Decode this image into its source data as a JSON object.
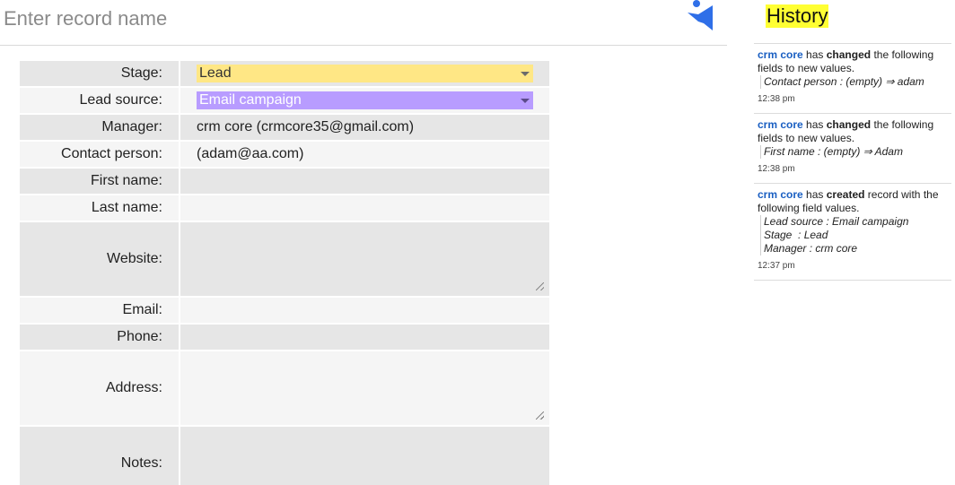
{
  "header": {
    "record_name_placeholder": "Enter record name"
  },
  "form": {
    "stage": {
      "label": "Stage:",
      "value": "Lead"
    },
    "lead_source": {
      "label": "Lead source:",
      "value": "Email campaign"
    },
    "manager": {
      "label": "Manager:",
      "value": "crm core (crmcore35@gmail.com)"
    },
    "contact_person": {
      "label": "Contact person:",
      "value": "(adam@aa.com)"
    },
    "first_name": {
      "label": "First name:",
      "value": ""
    },
    "last_name": {
      "label": "Last name:",
      "value": ""
    },
    "website": {
      "label": "Website:",
      "value": ""
    },
    "email": {
      "label": "Email:",
      "value": ""
    },
    "phone": {
      "label": "Phone:",
      "value": ""
    },
    "address": {
      "label": "Address:",
      "value": ""
    },
    "notes": {
      "label": "Notes:",
      "value": ""
    }
  },
  "history": {
    "title": "History",
    "entries": [
      {
        "user": "crm core",
        "action_pre": "has",
        "action": "changed",
        "action_post": "the following fields to new values.",
        "changes": [
          "Contact person : (empty) ⇒ adam"
        ],
        "time": "12:38 pm"
      },
      {
        "user": "crm core",
        "action_pre": "has",
        "action": "changed",
        "action_post": "the following fields to new values.",
        "changes": [
          "First name : (empty) ⇒ Adam"
        ],
        "time": "12:38 pm"
      },
      {
        "user": "crm core",
        "action_pre": "has",
        "action": "created",
        "action_post": "record with the following field values.",
        "changes": [
          "Lead source : Email campaign",
          "Stage  : Lead",
          "Manager : crm core"
        ],
        "time": "12:37 pm"
      }
    ]
  },
  "colors": {
    "stage_bg": "#ffe785",
    "lead_source_bg": "#b89cff",
    "history_highlight": "#ffff33",
    "user_link": "#1a5fc2",
    "logo_blue": "#2f6fe8"
  },
  "icons": {
    "logo": "person-logo-icon",
    "dropdown": "caret-down-icon",
    "resize": "resize-grip-icon"
  }
}
